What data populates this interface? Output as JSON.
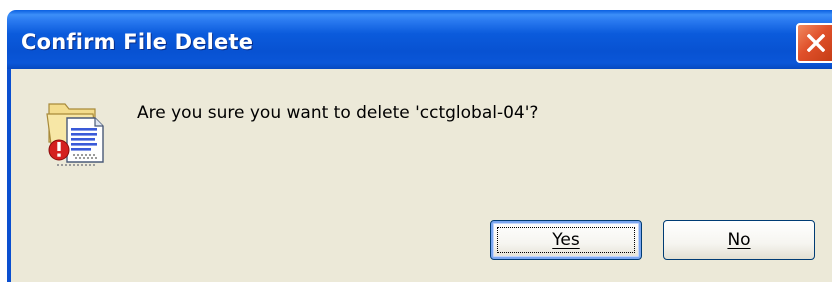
{
  "window": {
    "title": "Confirm File Delete",
    "close_icon": "close-x-icon",
    "close_color": "#e0502a",
    "titlebar_color": "#0a5be0",
    "body_color": "#ece9d8"
  },
  "content": {
    "icon": "delete-file-warning-icon",
    "message": "Are you sure you want to delete 'cctglobal-04'?"
  },
  "buttons": {
    "yes_label": "Yes",
    "no_label": "No",
    "default": "Yes"
  }
}
